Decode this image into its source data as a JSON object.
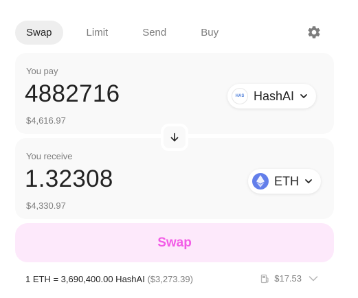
{
  "tabs": [
    {
      "label": "Swap",
      "active": true
    },
    {
      "label": "Limit",
      "active": false
    },
    {
      "label": "Send",
      "active": false
    },
    {
      "label": "Buy",
      "active": false
    }
  ],
  "pay": {
    "label": "You pay",
    "amount": "4882716",
    "usd": "$4,616.97",
    "token": {
      "icon_text": "HAS",
      "symbol": "HashAI"
    }
  },
  "receive": {
    "label": "You receive",
    "amount": "1.32308",
    "usd": "$4,330.97",
    "token": {
      "symbol": "ETH"
    }
  },
  "swap_button": "Swap",
  "footer": {
    "rate": "1 ETH = 3,690,400.00 HashAI",
    "rate_usd": "($3,273.39)",
    "gas": "$17.53"
  },
  "colors": {
    "accent": "#f25ce6",
    "accent_bg": "#fde9fb",
    "panel": "#f9f9f9",
    "eth": "#627eea"
  },
  "icons": [
    "gear-icon",
    "arrow-down-icon",
    "chevron-down-icon",
    "ethereum-icon",
    "gas-pump-icon"
  ]
}
